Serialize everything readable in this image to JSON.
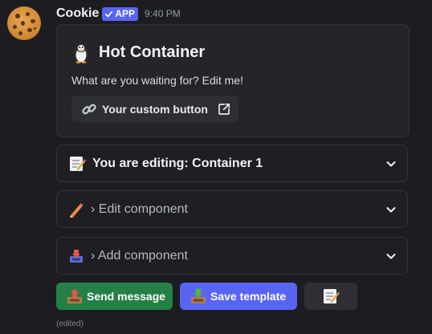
{
  "message": {
    "username": "Cookie",
    "app_badge": "APP",
    "timestamp": "9:40 PM",
    "edited": "(edited)",
    "avatar_icon": "cookie-icon"
  },
  "container": {
    "title": "Hot Container",
    "title_icon": "penguin-icon",
    "description": "What are you waiting for? Edit me!",
    "link_button": {
      "label": "Your custom button",
      "icon": "link-icon",
      "trailing_icon": "external-link-icon"
    }
  },
  "selects": [
    {
      "label": "You are editing: Container 1",
      "icon": "memo-icon"
    },
    {
      "label": "› Edit component",
      "icon": "pencil-icon"
    },
    {
      "label": "› Add component",
      "icon": "inbox-tray-icon"
    }
  ],
  "actions": {
    "send": {
      "label": "Send message",
      "icon": "outbox-tray-icon",
      "color": "#248046"
    },
    "save": {
      "label": "Save template",
      "icon": "inbox-tray-icon",
      "color": "#5865f2"
    },
    "edit": {
      "icon": "memo-icon"
    }
  },
  "colors": {
    "background": "#1c1c21",
    "accent": "#5865f2",
    "success": "#248046"
  }
}
